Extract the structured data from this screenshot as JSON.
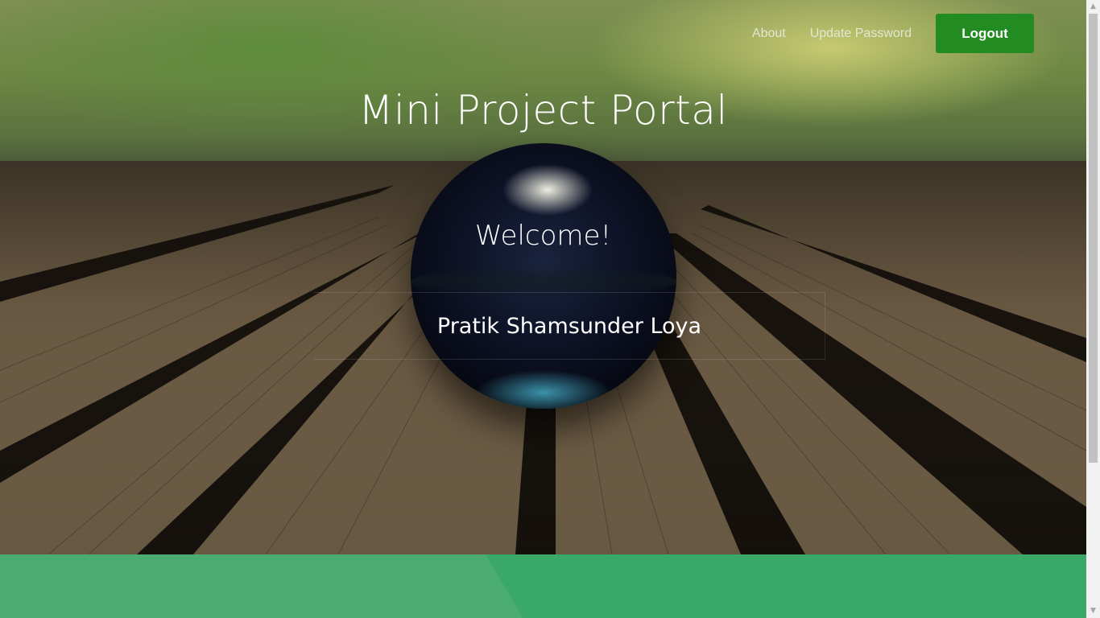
{
  "nav": {
    "about_label": "About",
    "update_password_label": "Update Password",
    "logout_label": "Logout"
  },
  "hero": {
    "title": "Mini Project Portal",
    "welcome": "Welcome!",
    "user_name": "Pratik Shamsunder Loya"
  },
  "colors": {
    "logout_button": "#228b22",
    "footer_band": "#3aa867",
    "footer_band_light": "#4aac70"
  },
  "icons": {
    "scroll_up": "triangle-up-icon",
    "scroll_down": "triangle-down-icon"
  }
}
